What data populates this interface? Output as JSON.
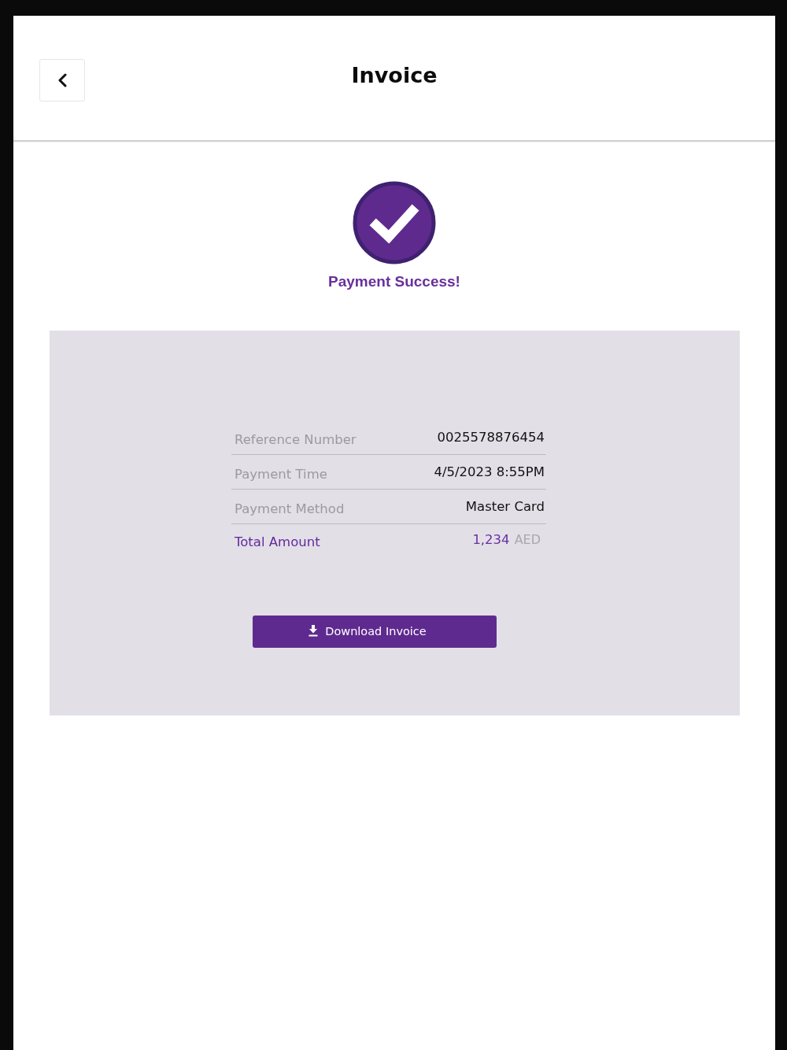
{
  "header": {
    "title": "Invoice"
  },
  "status": {
    "message": "Payment Success!"
  },
  "details": [
    {
      "kind": "plain",
      "label": "Reference Number",
      "value": "0025578876454"
    },
    {
      "kind": "plain",
      "label": "Payment Time",
      "value": "4/5/2023 8:55PM"
    },
    {
      "kind": "plain",
      "label": "Payment Method",
      "value": "Master Card"
    },
    {
      "kind": "total",
      "label": "Total Amount",
      "amount": "1,234",
      "currency": "AED"
    }
  ],
  "download_button": {
    "label": "Download Invoice"
  }
}
